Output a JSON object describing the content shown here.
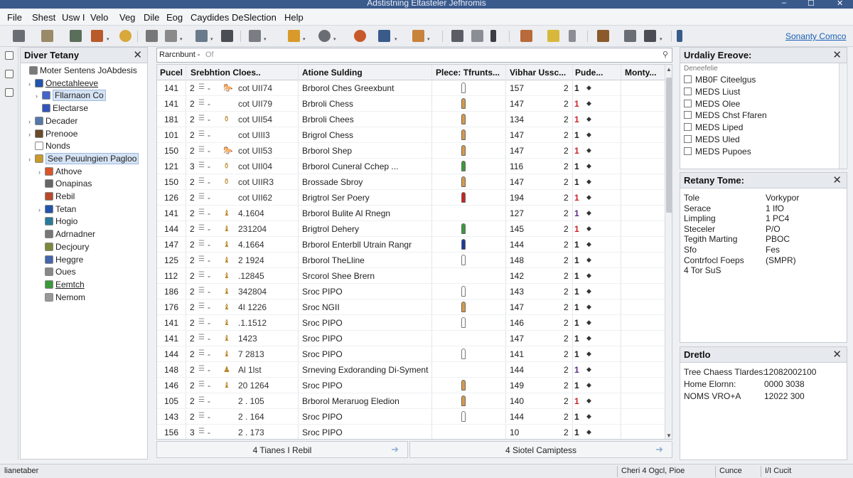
{
  "window": {
    "title": "Adstistning Eltasteler Jefhromis",
    "minimize": "–",
    "maximize": "☐",
    "close": "✕"
  },
  "menu": [
    "File",
    "Shest",
    "Usw I",
    "Velo",
    "Veg",
    "Dile",
    "Eog",
    "Caydides",
    "DeSlection",
    "Help"
  ],
  "toolbar": {
    "link": "Sonanty Comco"
  },
  "left_panel": {
    "title": "Diver Tetany",
    "close": "✕",
    "tree": [
      {
        "label": "Moter Sentens JoAbdesis",
        "arrow": "",
        "icon_color": "#7a7a7a"
      },
      {
        "label": "Onectahleeve",
        "arrow": "›",
        "icon_color": "#2255aa",
        "underline": true
      },
      {
        "label": "Fllarnaon Co",
        "arrow": "›",
        "icon_color": "#4466cc",
        "selected": true
      },
      {
        "label": "Electarse",
        "arrow": "",
        "icon_color": "#3355bb"
      },
      {
        "label": "Decader",
        "arrow": "›",
        "icon_color": "#5577aa"
      },
      {
        "label": "Prenooe",
        "arrow": "›",
        "icon_color": "#6a4a2a"
      },
      {
        "label": "Nonds",
        "arrow": "",
        "icon_color": "#ffffff"
      },
      {
        "label": "See Peuulngien Pagloo",
        "arrow": "›",
        "icon_color": "#c89a2a",
        "selected": true
      },
      {
        "label": "Athove",
        "arrow": "›",
        "icon_color": "#d8542a"
      },
      {
        "label": "Onapinas",
        "arrow": "",
        "icon_color": "#666666"
      },
      {
        "label": "Rebil",
        "arrow": "",
        "icon_color": "#b84a2a"
      },
      {
        "label": "Tetan",
        "arrow": "›",
        "icon_color": "#2255aa"
      },
      {
        "label": "Hogio",
        "arrow": "",
        "icon_color": "#2a7a9a"
      },
      {
        "label": "Adrnadner",
        "arrow": "",
        "icon_color": "#777777"
      },
      {
        "label": "Decjoury",
        "arrow": "",
        "icon_color": "#7a8a3a"
      },
      {
        "label": "Heggre",
        "arrow": "",
        "icon_color": "#4466aa"
      },
      {
        "label": "Oues",
        "arrow": "",
        "icon_color": "#888888"
      },
      {
        "label": "Eemtch",
        "arrow": "",
        "icon_color": "#3a9a3a",
        "underline": true
      },
      {
        "label": "Nemom",
        "arrow": "",
        "icon_color": "#999999"
      }
    ]
  },
  "address": {
    "value": "Rarcnbunt -",
    "placeholder": "Of",
    "icon": "search-icon"
  },
  "grid": {
    "columns": [
      "Pucel",
      "Srebhtion Cloes..",
      "Atione Sulding",
      "Plece: Tfrunts...",
      "Vibhar Ussc...",
      "Pude...",
      "Monty..."
    ],
    "rows": [
      {
        "id": "141",
        "n": "2",
        "dash": "-",
        "ic": "🐎",
        "code": "cot UII74",
        "name": "Brborol Ches Greexbunt",
        "piece": "tan-outline",
        "vis": "157",
        "pude": "2",
        "arrow": "1",
        "arrow_color": "#222222"
      },
      {
        "id": "141",
        "n": "2",
        "dash": "-",
        "ic": "",
        "code": "cot UII79",
        "name": "Brbroli Chess",
        "piece": "tan",
        "vis": "147",
        "pude": "2",
        "arrow": "1",
        "arrow_color": "#cc2222"
      },
      {
        "id": "181",
        "n": "2",
        "dash": "-",
        "ic": "⚱",
        "code": "cot UII54",
        "name": "Brbroli Chees",
        "piece": "tan",
        "vis": "134",
        "pude": "2",
        "arrow": "1",
        "arrow_color": "#cc2222"
      },
      {
        "id": "101",
        "n": "2",
        "dash": "-",
        "ic": "",
        "code": "cot UIII3",
        "name": "Brigrol Chess",
        "piece": "tan",
        "vis": "147",
        "pude": "2",
        "arrow": "1",
        "arrow_color": "#222222"
      },
      {
        "id": "150",
        "n": "2",
        "dash": "-",
        "ic": "🐎",
        "code": "cot UII53",
        "name": "Brborol Shep",
        "piece": "tan",
        "vis": "147",
        "pude": "2",
        "arrow": "1",
        "arrow_color": "#cc2222"
      },
      {
        "id": "121",
        "n": "3",
        "dash": "-",
        "ic": "⚱",
        "code": "cot UII04",
        "name": "Brborol Cuneral Cchep ...",
        "piece": "green",
        "vis": "116",
        "pude": "2",
        "arrow": "1",
        "arrow_color": "#222222"
      },
      {
        "id": "150",
        "n": "2",
        "dash": "-",
        "ic": "⚱",
        "code": "cot UIIR3",
        "name": "Brossade Sbroy",
        "piece": "tan",
        "vis": "147",
        "pude": "2",
        "arrow": "1",
        "arrow_color": "#222222"
      },
      {
        "id": "126",
        "n": "2",
        "dash": "-",
        "ic": "",
        "code": "cot UII62",
        "name": "Brigtrol Ser Poery",
        "piece": "red",
        "vis": "194",
        "pude": "2",
        "arrow": "1",
        "arrow_color": "#cc2222"
      },
      {
        "id": "141",
        "n": "2",
        "dash": "-",
        "ic": "♝",
        "code": "4.1604",
        "name": "Brborol Bulite Al Rnegn",
        "piece": "",
        "vis": "127",
        "pude": "2",
        "arrow": "1",
        "arrow_color": "#5a2a8a"
      },
      {
        "id": "144",
        "n": "2",
        "dash": "-",
        "ic": "♝",
        "code": "231204",
        "name": "Brigtrol Dehery",
        "piece": "green",
        "vis": "145",
        "pude": "2",
        "arrow": "1",
        "arrow_color": "#cc2222"
      },
      {
        "id": "147",
        "n": "2",
        "dash": "-",
        "ic": "♝",
        "code": "4.1664",
        "name": "Brborol Enterbll Utrain Rangr",
        "piece": "blue",
        "vis": "144",
        "pude": "2",
        "arrow": "1",
        "arrow_color": "#222222"
      },
      {
        "id": "125",
        "n": "2",
        "dash": "-",
        "ic": "♝",
        "code": "2 1924",
        "name": "Brborol TheLline",
        "piece": "outline",
        "vis": "148",
        "pude": "2",
        "arrow": "1",
        "arrow_color": "#222222"
      },
      {
        "id": "112",
        "n": "2",
        "dash": "-",
        "ic": "♝",
        "code": ".12845",
        "name": "Srcorol Shee Brern",
        "piece": "",
        "vis": "142",
        "pude": "2",
        "arrow": "1",
        "arrow_color": "#222222"
      },
      {
        "id": "186",
        "n": "2",
        "dash": "-",
        "ic": "♝",
        "code": "342804",
        "name": "Sroc PIPO",
        "piece": "outline",
        "vis": "143",
        "pude": "2",
        "arrow": "1",
        "arrow_color": "#222222"
      },
      {
        "id": "176",
        "n": "2",
        "dash": "-",
        "ic": "♝",
        "code": "4I 1226",
        "name": "Sroc NGII",
        "piece": "tan",
        "vis": "147",
        "pude": "2",
        "arrow": "1",
        "arrow_color": "#222222"
      },
      {
        "id": "141",
        "n": "2",
        "dash": "-",
        "ic": "♝",
        "code": ".1.1512",
        "name": "Sroc PIPO",
        "piece": "outline",
        "vis": "146",
        "pude": "2",
        "arrow": "1",
        "arrow_color": "#222222"
      },
      {
        "id": "141",
        "n": "2",
        "dash": "-",
        "ic": "♝",
        "code": "1423",
        "name": "Sroc PIPO",
        "piece": "",
        "vis": "147",
        "pude": "2",
        "arrow": "1",
        "arrow_color": "#222222"
      },
      {
        "id": "144",
        "n": "2",
        "dash": "-",
        "ic": "♝",
        "code": "7 2813",
        "name": "Sroc PIPO",
        "piece": "outline",
        "vis": "141",
        "pude": "2",
        "arrow": "1",
        "arrow_color": "#222222"
      },
      {
        "id": "148",
        "n": "2",
        "dash": "-",
        "ic": "♟",
        "code": "Al 1lst",
        "name": "Srneving Exdoranding Di-Syment",
        "piece": "",
        "vis": "144",
        "pude": "2",
        "arrow": "1",
        "arrow_color": "#5a2a8a"
      },
      {
        "id": "146",
        "n": "2",
        "dash": "-",
        "ic": "♝",
        "code": "20 1264",
        "name": "Sroc PIPO",
        "piece": "tan",
        "vis": "149",
        "pude": "2",
        "arrow": "1",
        "arrow_color": "#222222"
      },
      {
        "id": "105",
        "n": "2",
        "dash": "-",
        "ic": "",
        "code": "2 . 105",
        "name": "Brborol Meraruog Eledion",
        "piece": "tan",
        "vis": "140",
        "pude": "2",
        "arrow": "1",
        "arrow_color": "#cc2222"
      },
      {
        "id": "143",
        "n": "2",
        "dash": "-",
        "ic": "",
        "code": "2 . 164",
        "name": "Sroc PIPO",
        "piece": "outline",
        "vis": "144",
        "pude": "2",
        "arrow": "1",
        "arrow_color": "#222222"
      },
      {
        "id": "156",
        "n": "3",
        "dash": "-",
        "ic": "",
        "code": "2 . 173",
        "name": "Sroc PIPO",
        "piece": "",
        "vis": "10",
        "pude": "2",
        "arrow": "1",
        "arrow_color": "#222222"
      }
    ]
  },
  "bottom_buttons": {
    "left": "4 Tianes I Rebil",
    "right": "4 Siotel Camiptess"
  },
  "right_top": {
    "title": "Urdaliy Ereove:",
    "subtitle": "Deneefelie",
    "items": [
      "MB0F Citeelgus",
      "MEDS Liust",
      "MEDS Olee",
      "MEDS Chst Ffaren",
      "MEDS Liped",
      "MEDS Uled",
      "MEDS Pupoes"
    ]
  },
  "right_mid": {
    "title": "Retany Tome:",
    "rows": [
      {
        "k": "Tole",
        "v": "Vorkypor"
      },
      {
        "k": "Serace",
        "v": "1 IfO"
      },
      {
        "k": "Limpling",
        "v": "1 PC4"
      },
      {
        "k": "Steceler",
        "v": "P/O"
      },
      {
        "k": "Tegith Marting",
        "v": "PBOC"
      },
      {
        "k": "Sfo",
        "v": "Fes"
      },
      {
        "k": "Contrfocl Foeps",
        "v": "(SMPR)"
      },
      {
        "k": "4 Tor SuS",
        "v": ""
      }
    ]
  },
  "right_bottom": {
    "title": "Dretlo",
    "rows": [
      {
        "k": "Tree Chaess Tlardes:",
        "v": "12082002100"
      },
      {
        "k": "Home Elornn:",
        "v": "0000 3038"
      },
      {
        "k": "NOMS VRO+A",
        "v": "12022 300"
      }
    ]
  },
  "status": {
    "left": "lianetaber",
    "s1": "Cheri 4 Ogcl, Pioe",
    "s2": "Cunce",
    "s3": "I/I Cucit"
  }
}
